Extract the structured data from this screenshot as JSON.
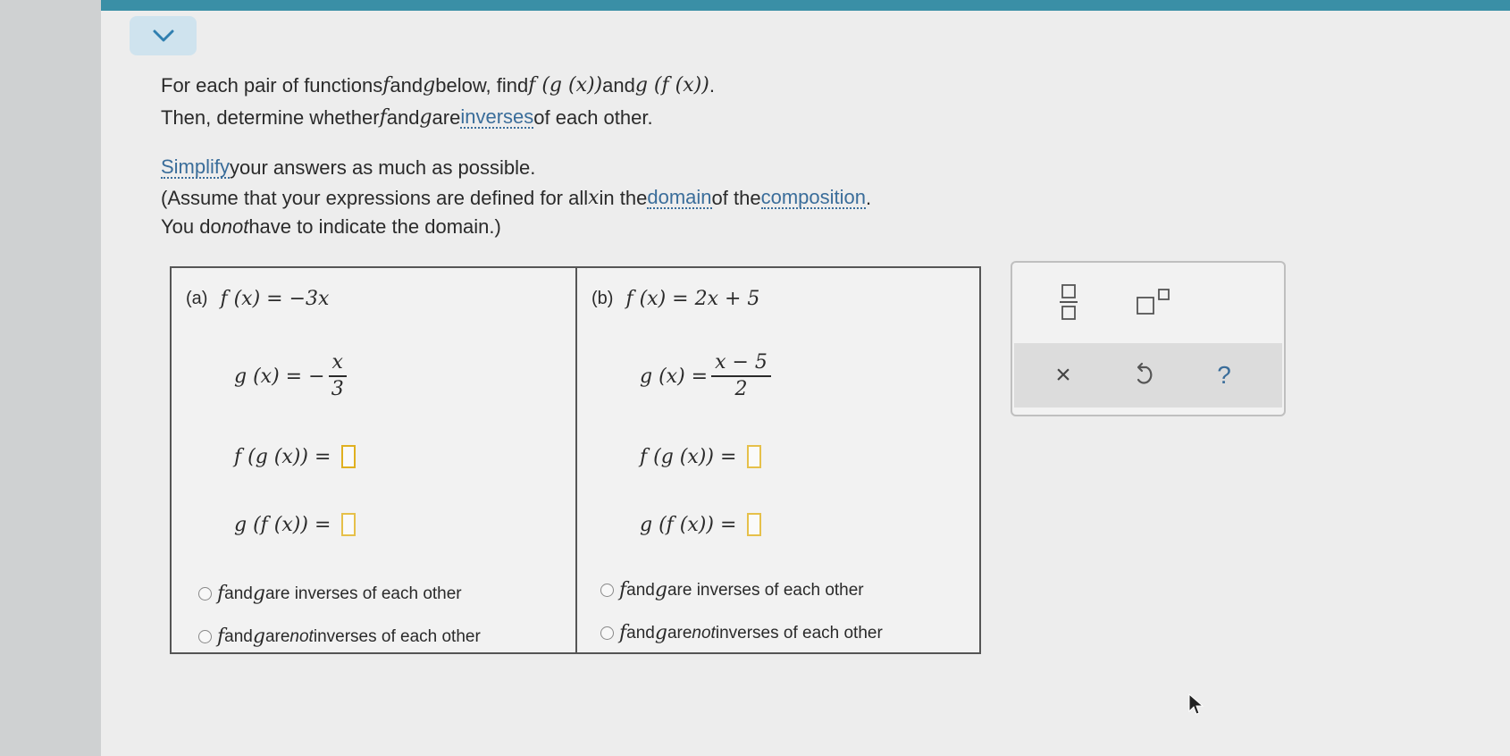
{
  "instructions": {
    "line1_a": "For each pair of functions ",
    "line1_f": "f",
    "line1_b": " and ",
    "line1_g": "g",
    "line1_c": " below, find ",
    "line1_fg": "f (g (x))",
    "line1_d": " and ",
    "line1_gf": "g (f (x))",
    "line1_e": ".",
    "line2_a": "Then, determine whether ",
    "line2_f": "f",
    "line2_b": " and ",
    "line2_g": "g",
    "line2_c": " are ",
    "line2_link": "inverses",
    "line2_d": " of each other.",
    "line3_link": "Simplify",
    "line3_rest": " your answers as much as possible.",
    "line4_a": "(Assume that your expressions are defined for all ",
    "line4_x": "x",
    "line4_b": " in the ",
    "line4_link1": "domain",
    "line4_c": " of the ",
    "line4_link2": "composition",
    "line4_d": ".",
    "line5_a": "You do ",
    "line5_not": "not",
    "line5_b": " have to indicate the domain.)"
  },
  "parts": [
    {
      "label": "(a)",
      "f_def": "f (x) = −3x",
      "g_lhs": "g (x) = −",
      "g_num": "x",
      "g_den": "3",
      "fg_lhs": "f (g (x)) =",
      "gf_lhs": "g (f (x)) =",
      "fg_value": "",
      "gf_value": "",
      "opt_inverse": {
        "f": "f",
        "mid": " and ",
        "g": "g",
        "rest": " are inverses of each other"
      },
      "opt_not_inverse": {
        "f": "f",
        "mid": " and ",
        "g": "g",
        "are": " are ",
        "not": "not",
        "rest": " inverses of each other"
      }
    },
    {
      "label": "(b)",
      "f_def": "f (x) = 2x + 5",
      "g_lhs": "g (x) =",
      "g_num": "x − 5",
      "g_den": "2",
      "fg_lhs": "f (g (x)) =",
      "gf_lhs": "g (f (x)) =",
      "fg_value": "",
      "gf_value": "",
      "opt_inverse": {
        "f": "f",
        "mid": " and ",
        "g": "g",
        "rest": " are inverses of each other"
      },
      "opt_not_inverse": {
        "f": "f",
        "mid": " and ",
        "g": "g",
        "are": " are ",
        "not": "not",
        "rest": " inverses of each other"
      }
    }
  ],
  "tools": {
    "fraction_icon": "fraction-template-icon",
    "exponent_icon": "exponent-template-icon",
    "clear_label": "×",
    "undo_icon": "undo-icon",
    "help_label": "?"
  },
  "colors": {
    "accent": "#3a8fa6",
    "link": "#3a6d9a",
    "answer_box": "#e0b020"
  }
}
